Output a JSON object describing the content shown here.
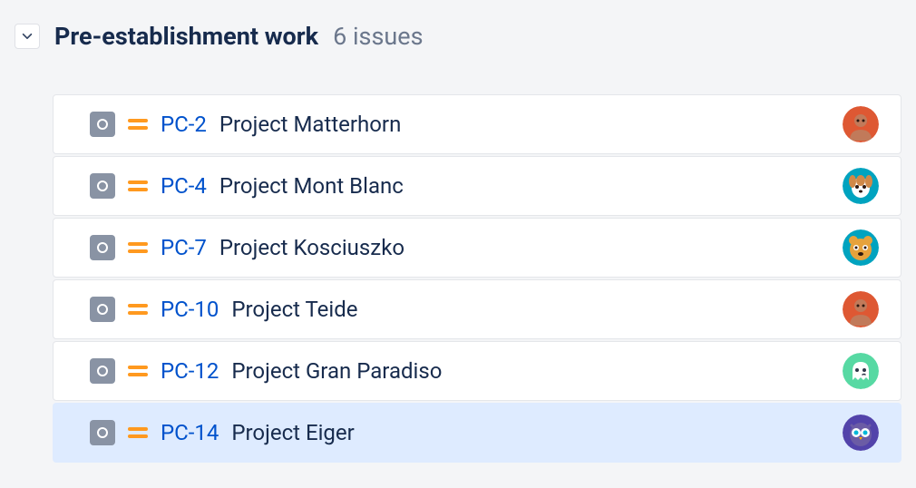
{
  "section": {
    "title": "Pre-establishment work",
    "count_label": "6 issues"
  },
  "issues": [
    {
      "key": "PC-2",
      "title": "Project Matterhorn",
      "avatar": "person-orange",
      "selected": false
    },
    {
      "key": "PC-4",
      "title": "Project Mont Blanc",
      "avatar": "dog-cyan",
      "selected": false
    },
    {
      "key": "PC-7",
      "title": "Project Kosciuszko",
      "avatar": "bear-teal",
      "selected": false
    },
    {
      "key": "PC-10",
      "title": "Project Teide",
      "avatar": "person-orange",
      "selected": false
    },
    {
      "key": "PC-12",
      "title": "Project Gran Paradiso",
      "avatar": "ghost-mint",
      "selected": false
    },
    {
      "key": "PC-14",
      "title": "Project Eiger",
      "avatar": "owl-purple",
      "selected": true
    }
  ],
  "avatar_colors": {
    "person-orange": "#de5833",
    "dog-cyan": "#00a3bf",
    "bear-teal": "#00a3bf",
    "ghost-mint": "#57d9a3",
    "owl-purple": "#5243aa"
  }
}
